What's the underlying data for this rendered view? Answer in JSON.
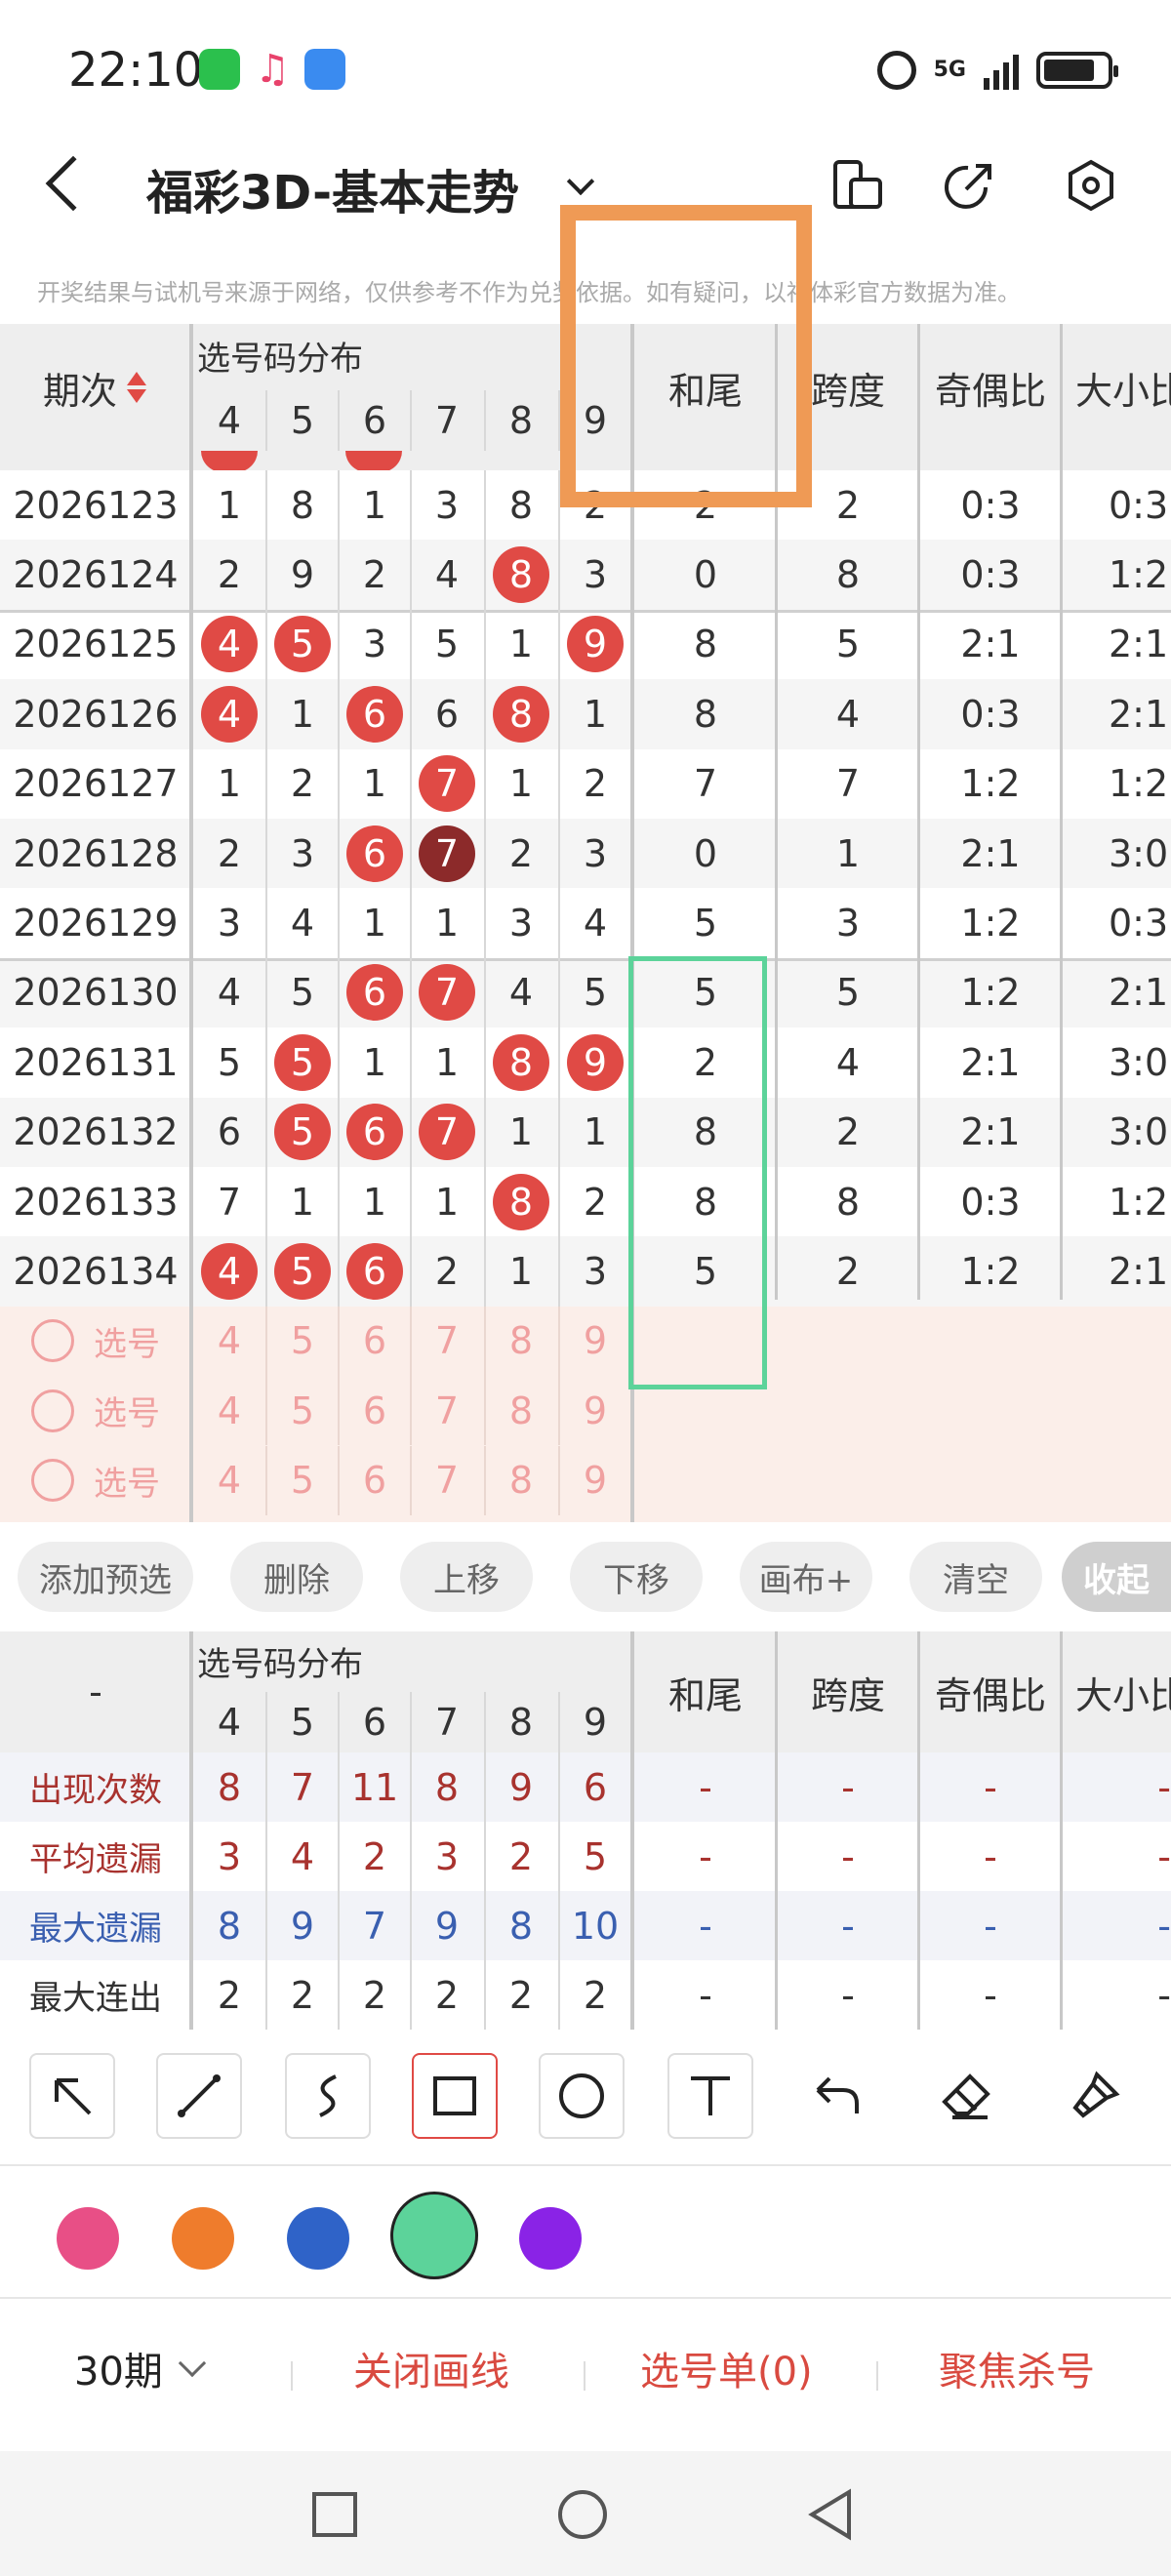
{
  "status": {
    "time": "22:10",
    "network": "5G"
  },
  "header": {
    "title": "福彩3D-基本走势"
  },
  "notice": "开奖结果与试机号来源于网络，仅供参考不作为兑奖依据。如有疑问，以福体彩官方数据为准。",
  "trend_table": {
    "col_issue": "期次",
    "col_distribution": "选号码分布",
    "digits": [
      "4",
      "5",
      "6",
      "7",
      "8",
      "9"
    ],
    "col_sum_tail": "和尾",
    "col_span": "跨度",
    "col_odd_even": "奇偶比",
    "col_big_small": "大小比",
    "rows": [
      {
        "issue": "2026123",
        "cells": [
          "1",
          "8",
          "1",
          "3",
          "8",
          "2"
        ],
        "balls": [],
        "sum_tail": "2",
        "span": "2",
        "odd_even": "0:3",
        "big_small": "0:3"
      },
      {
        "issue": "2026124",
        "cells": [
          "2",
          "9",
          "2",
          "4",
          "8",
          "3"
        ],
        "balls": [
          4
        ],
        "sum_tail": "0",
        "span": "8",
        "odd_even": "0:3",
        "big_small": "1:2"
      },
      {
        "issue": "2026125",
        "cells": [
          "4",
          "5",
          "3",
          "5",
          "1",
          "9"
        ],
        "balls": [
          0,
          1,
          5
        ],
        "sum_tail": "8",
        "span": "5",
        "odd_even": "2:1",
        "big_small": "2:1"
      },
      {
        "issue": "2026126",
        "cells": [
          "4",
          "1",
          "6",
          "6",
          "8",
          "1"
        ],
        "balls": [
          0,
          2,
          4
        ],
        "sum_tail": "8",
        "span": "4",
        "odd_even": "0:3",
        "big_small": "2:1"
      },
      {
        "issue": "2026127",
        "cells": [
          "1",
          "2",
          "1",
          "7",
          "1",
          "2"
        ],
        "balls": [
          3
        ],
        "sum_tail": "7",
        "span": "7",
        "odd_even": "1:2",
        "big_small": "1:2"
      },
      {
        "issue": "2026128",
        "cells": [
          "2",
          "3",
          "6",
          "7",
          "2",
          "3"
        ],
        "balls": [
          2,
          3
        ],
        "dark": [
          3
        ],
        "sum_tail": "0",
        "span": "1",
        "odd_even": "2:1",
        "big_small": "3:0"
      },
      {
        "issue": "2026129",
        "cells": [
          "3",
          "4",
          "1",
          "1",
          "3",
          "4"
        ],
        "balls": [],
        "sum_tail": "5",
        "span": "3",
        "odd_even": "1:2",
        "big_small": "0:3"
      },
      {
        "issue": "2026130",
        "cells": [
          "4",
          "5",
          "6",
          "7",
          "4",
          "5"
        ],
        "balls": [
          2,
          3
        ],
        "sum_tail": "5",
        "span": "5",
        "odd_even": "1:2",
        "big_small": "2:1"
      },
      {
        "issue": "2026131",
        "cells": [
          "5",
          "5",
          "1",
          "1",
          "8",
          "9"
        ],
        "balls": [
          1,
          4,
          5
        ],
        "sum_tail": "2",
        "span": "4",
        "odd_even": "2:1",
        "big_small": "3:0"
      },
      {
        "issue": "2026132",
        "cells": [
          "6",
          "5",
          "6",
          "7",
          "1",
          "1"
        ],
        "balls": [
          1,
          2,
          3
        ],
        "sum_tail": "8",
        "span": "2",
        "odd_even": "2:1",
        "big_small": "3:0"
      },
      {
        "issue": "2026133",
        "cells": [
          "7",
          "1",
          "1",
          "1",
          "8",
          "2"
        ],
        "balls": [
          4
        ],
        "sum_tail": "8",
        "span": "8",
        "odd_even": "0:3",
        "big_small": "1:2"
      },
      {
        "issue": "2026134",
        "cells": [
          "4",
          "5",
          "6",
          "2",
          "1",
          "3"
        ],
        "balls": [
          0,
          1,
          2
        ],
        "sum_tail": "5",
        "span": "2",
        "odd_even": "1:2",
        "big_small": "2:1"
      }
    ],
    "preset_rows": [
      {
        "label": "选号",
        "digits": [
          "4",
          "5",
          "6",
          "7",
          "8",
          "9"
        ]
      },
      {
        "label": "选号",
        "digits": [
          "4",
          "5",
          "6",
          "7",
          "8",
          "9"
        ]
      },
      {
        "label": "选号",
        "digits": [
          "4",
          "5",
          "6",
          "7",
          "8",
          "9"
        ]
      }
    ]
  },
  "actions": [
    "添加预选",
    "删除",
    "上移",
    "下移",
    "画布+",
    "清空",
    "收起"
  ],
  "stats_table": {
    "corner": "-",
    "col_distribution": "选号码分布",
    "digits": [
      "4",
      "5",
      "6",
      "7",
      "8",
      "9"
    ],
    "col_sum_tail": "和尾",
    "col_span": "跨度",
    "col_odd_even": "奇偶比",
    "col_big_small": "大小比",
    "rows": [
      {
        "label": "出现次数",
        "color": "#a8322e",
        "values": [
          "8",
          "7",
          "11",
          "8",
          "9",
          "6"
        ],
        "rest": [
          "-",
          "-",
          "-",
          "-"
        ]
      },
      {
        "label": "平均遗漏",
        "color": "#a8322e",
        "values": [
          "3",
          "4",
          "2",
          "3",
          "2",
          "5"
        ],
        "rest": [
          "-",
          "-",
          "-",
          "-"
        ]
      },
      {
        "label": "最大遗漏",
        "color": "#3a5fb0",
        "values": [
          "8",
          "9",
          "7",
          "9",
          "8",
          "10"
        ],
        "rest": [
          "-",
          "-",
          "-",
          "-"
        ]
      },
      {
        "label": "最大连出",
        "color": "#333333",
        "values": [
          "2",
          "2",
          "2",
          "2",
          "2",
          "2"
        ],
        "rest": [
          "-",
          "-",
          "-",
          "-"
        ]
      }
    ]
  },
  "tools": [
    "arrow-tool-icon",
    "line-tool-icon",
    "curve-tool-icon",
    "rect-tool-icon",
    "circle-tool-icon",
    "text-tool-icon",
    "undo-icon",
    "eraser-icon",
    "clear-brush-icon"
  ],
  "palette": [
    "#e84f86",
    "#ef7c2c",
    "#2f63c8",
    "#5cd39a",
    "#8a23e6"
  ],
  "bottom": {
    "period": "30期",
    "close_lines": "关闭画线",
    "selection": "选号单(0)",
    "focus": "聚焦杀号"
  }
}
